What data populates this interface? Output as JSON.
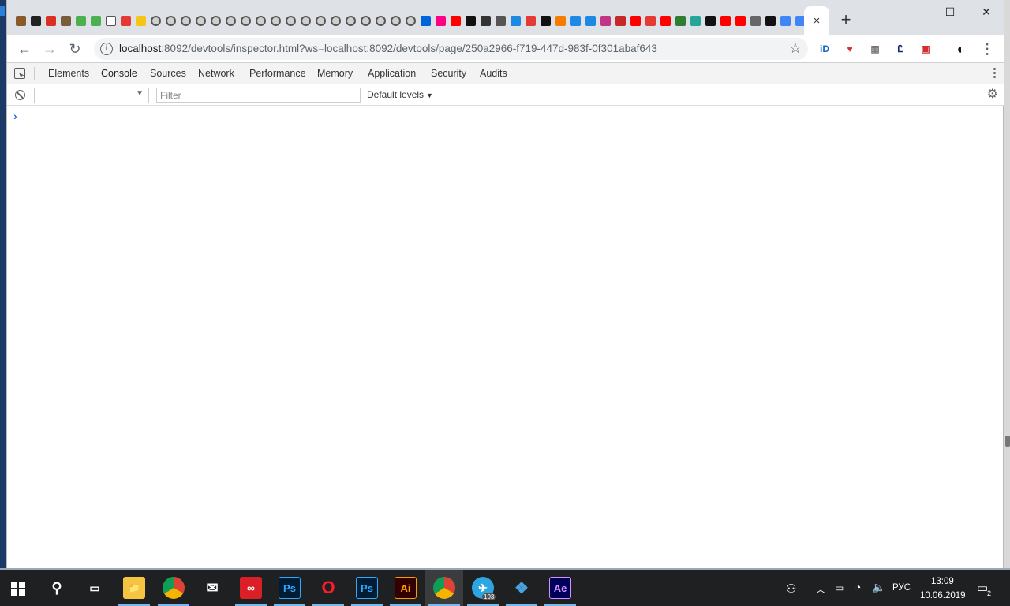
{
  "browser": {
    "active_tab_close": "×",
    "new_tab": "+",
    "window_controls": {
      "minimize": "—",
      "maximize": "☐",
      "close": "✕"
    },
    "pinned_tabs": [
      {
        "icon": "beaver-icon",
        "color": "#8b5a2b"
      },
      {
        "icon": "p-icon",
        "color": "#222222"
      },
      {
        "icon": "gmail-icon",
        "color": "#d93025"
      },
      {
        "icon": "pocket-icon",
        "color": "#7a5c3a"
      },
      {
        "icon": "leaf-icon",
        "color": "#4caf50"
      },
      {
        "icon": "leaf-icon",
        "color": "#4caf50"
      },
      {
        "icon": "calendar-20-icon",
        "color": "#ffffff"
      },
      {
        "icon": "adobe-icon",
        "color": "#e53935"
      },
      {
        "icon": "bulb-icon",
        "color": "#f5c518"
      },
      {
        "icon": "globe-icon",
        "color": "round"
      },
      {
        "icon": "globe-icon",
        "color": "round"
      },
      {
        "icon": "globe-icon",
        "color": "round"
      },
      {
        "icon": "globe-icon",
        "color": "round"
      },
      {
        "icon": "globe-icon",
        "color": "round"
      },
      {
        "icon": "globe-icon",
        "color": "round"
      },
      {
        "icon": "globe-icon",
        "color": "round"
      },
      {
        "icon": "globe-icon",
        "color": "round"
      },
      {
        "icon": "globe-icon",
        "color": "round"
      },
      {
        "icon": "globe-icon",
        "color": "round"
      },
      {
        "icon": "globe-icon",
        "color": "round"
      },
      {
        "icon": "globe-icon",
        "color": "round"
      },
      {
        "icon": "globe-icon",
        "color": "round"
      },
      {
        "icon": "globe-icon",
        "color": "round"
      },
      {
        "icon": "globe-icon",
        "color": "round"
      },
      {
        "icon": "globe-icon",
        "color": "round"
      },
      {
        "icon": "globe-icon",
        "color": "round"
      },
      {
        "icon": "globe-icon",
        "color": "round"
      },
      {
        "icon": "flickr-icon",
        "color": "#0063dc"
      },
      {
        "icon": "flickr-icon",
        "color": "#ff0084"
      },
      {
        "icon": "youtube-icon",
        "color": "#ff0000"
      },
      {
        "icon": "triangle-icon",
        "color": "#111111"
      },
      {
        "icon": "phone-icon",
        "color": "#333333"
      },
      {
        "icon": "apple-icon",
        "color": "#555555"
      },
      {
        "icon": "figma-icon",
        "color": "#1e88e5"
      },
      {
        "icon": "p-red-icon",
        "color": "#e53935"
      },
      {
        "icon": "triangle-icon",
        "color": "#111111"
      },
      {
        "icon": "apple-color-icon",
        "color": "#f57c00"
      },
      {
        "icon": "figma-icon",
        "color": "#1e88e5"
      },
      {
        "icon": "figma-icon",
        "color": "#1e88e5"
      },
      {
        "icon": "instagram-icon",
        "color": "#c13584"
      },
      {
        "icon": "heart-icon",
        "color": "#c62828"
      },
      {
        "icon": "youtube-icon",
        "color": "#ff0000"
      },
      {
        "icon": "p-red-icon",
        "color": "#e53935"
      },
      {
        "icon": "youtube-icon",
        "color": "#ff0000"
      },
      {
        "icon": "mushroom-icon",
        "color": "#2e7d32"
      },
      {
        "icon": "tile-icon",
        "color": "#26a69a"
      },
      {
        "icon": "c-icon",
        "color": "#111111"
      },
      {
        "icon": "youtube-icon",
        "color": "#ff0000"
      },
      {
        "icon": "youtube-icon",
        "color": "#ff0000"
      },
      {
        "icon": "pocket-icon",
        "color": "#666666"
      },
      {
        "icon": "github-icon",
        "color": "#111111"
      },
      {
        "icon": "google-icon",
        "color": "#4285f4"
      },
      {
        "icon": "google-icon",
        "color": "#4285f4"
      }
    ]
  },
  "toolbar": {
    "back": "←",
    "forward": "→",
    "reload": "↻",
    "url_host": "localhost",
    "url_rest": ":8092/devtools/inspector.html?ws=localhost:8092/devtools/page/250a2966-f719-447d-983f-0f301abaf643",
    "star": "☆",
    "menu": "⋮",
    "extensions": [
      {
        "name": "id-extension-icon",
        "label": "iD",
        "color": "#1565c0"
      },
      {
        "name": "pocket-extension-icon",
        "label": "♥",
        "color": "#d32f2f"
      },
      {
        "name": "incognito-extension-icon",
        "label": "▦",
        "color": "#777777"
      },
      {
        "name": "translate-extension-icon",
        "label": "Ꮭ",
        "color": "#1a237e"
      },
      {
        "name": "calendar-extension-icon",
        "label": "▣",
        "color": "#d32f2f"
      },
      {
        "name": "profile-avatar",
        "label": "◐",
        "color": "#111111"
      }
    ]
  },
  "devtools": {
    "tabs": [
      "Elements",
      "Console",
      "Sources",
      "Network",
      "Performance",
      "Memory",
      "Application",
      "Security",
      "Audits"
    ],
    "active_tab": "Console",
    "filter_placeholder": "Filter",
    "filter_value": "",
    "context_value": "",
    "levels_label": "Default levels",
    "prompt": "›"
  },
  "taskbar": {
    "apps": [
      {
        "name": "search-icon",
        "label": "⚲"
      },
      {
        "name": "task-view-icon",
        "label": "▭"
      },
      {
        "name": "file-explorer-icon",
        "label": "📁"
      },
      {
        "name": "chrome-icon",
        "label": ""
      },
      {
        "name": "mail-icon",
        "label": "✉"
      },
      {
        "name": "creative-cloud-icon",
        "label": "∞"
      },
      {
        "name": "photoshop-icon",
        "label": "Ps"
      },
      {
        "name": "opera-icon",
        "label": "O"
      },
      {
        "name": "photoshop-icon-2",
        "label": "Ps"
      },
      {
        "name": "illustrator-icon",
        "label": "Ai"
      },
      {
        "name": "chrome-active-icon",
        "label": ""
      },
      {
        "name": "telegram-icon",
        "label": "✈"
      },
      {
        "name": "app-cube-icon",
        "label": "❖"
      },
      {
        "name": "after-effects-icon",
        "label": "Ae"
      }
    ],
    "telegram_badge": "193",
    "tray": {
      "lang": "РУС",
      "time": "13:09",
      "date": "10.06.2019",
      "notifications": "2"
    }
  }
}
